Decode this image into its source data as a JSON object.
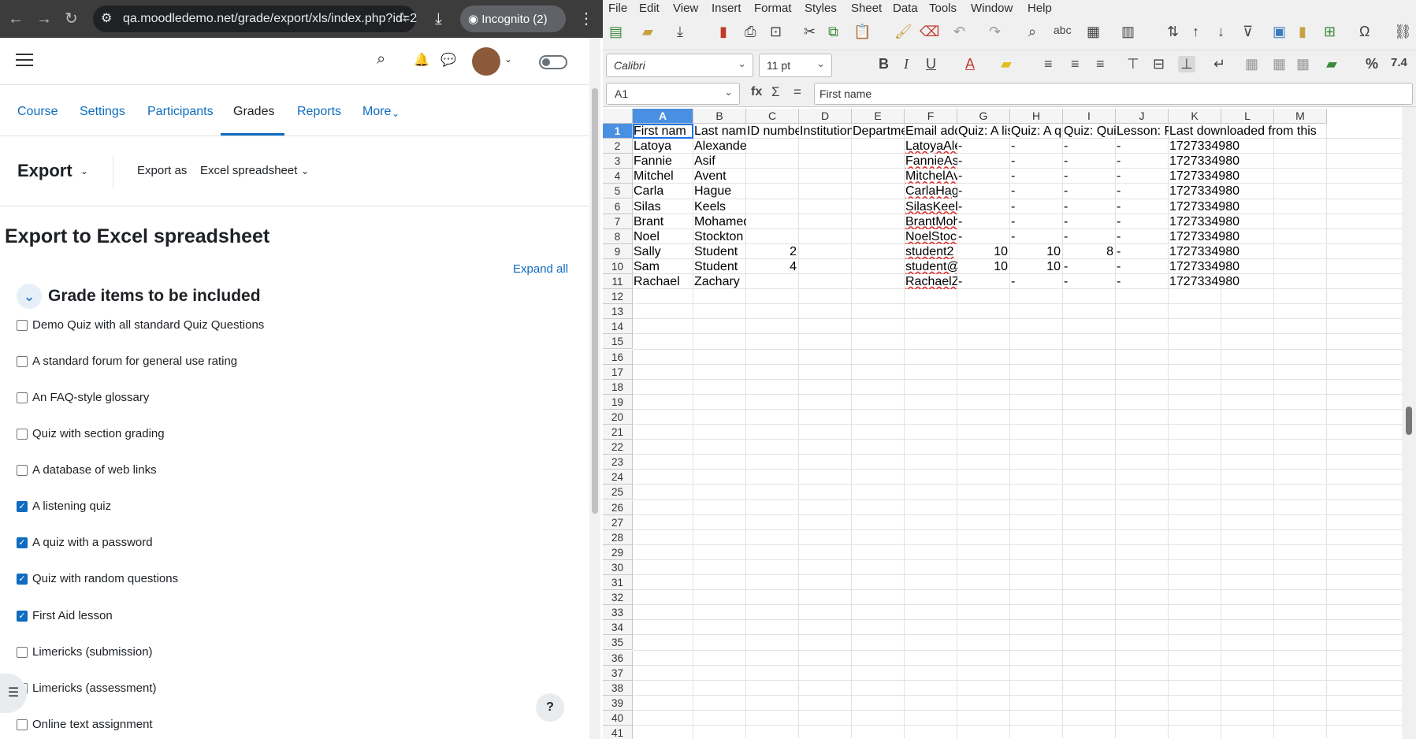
{
  "browser": {
    "url": "qa.moodledemo.net/grade/export/xls/index.php?id=2",
    "incognito_label": "Incognito (2)"
  },
  "moodle": {
    "nav_tabs": [
      "Course",
      "Settings",
      "Participants",
      "Grades",
      "Reports",
      "More"
    ],
    "active_tab": "Grades",
    "export_title": "Export",
    "export_as_label": "Export as",
    "export_format": "Excel spreadsheet",
    "page_heading": "Export to Excel spreadsheet",
    "expand_all": "Expand all",
    "section_title": "Grade items to be included",
    "grade_items": [
      {
        "label": "Demo Quiz with all standard Quiz Questions",
        "checked": false
      },
      {
        "label": "A standard forum for general use rating",
        "checked": false
      },
      {
        "label": "An FAQ-style glossary",
        "checked": false
      },
      {
        "label": "Quiz with section grading",
        "checked": false
      },
      {
        "label": "A database of web links",
        "checked": false
      },
      {
        "label": "A listening quiz",
        "checked": true
      },
      {
        "label": "A quiz with a password",
        "checked": true
      },
      {
        "label": "Quiz with random questions",
        "checked": true
      },
      {
        "label": "First Aid lesson",
        "checked": true
      },
      {
        "label": "Limericks (submission)",
        "checked": false
      },
      {
        "label": "Limericks (assessment)",
        "checked": false
      },
      {
        "label": "Online text assignment",
        "checked": false
      }
    ],
    "help_button": "?"
  },
  "calc": {
    "menus": [
      "File",
      "Edit",
      "View",
      "Insert",
      "Format",
      "Styles",
      "Sheet",
      "Data",
      "Tools",
      "Window",
      "Help"
    ],
    "font_name": "Calibri",
    "font_size": "11 pt",
    "name_box": "A1",
    "formula_value": "First name",
    "columns": [
      "A",
      "B",
      "C",
      "D",
      "E",
      "F",
      "G",
      "H",
      "I",
      "J",
      "K",
      "L",
      "M"
    ],
    "header_row": [
      "First nam",
      "Last nam",
      "ID numbe",
      "Institution",
      "Departme",
      "Email add",
      "Quiz: A lis",
      "Quiz: A q",
      "Quiz: Qui",
      "Lesson: F",
      "Last downloaded from this",
      "",
      ""
    ],
    "rows": [
      [
        "Latoya",
        "Alexander",
        "",
        "",
        "",
        "LatoyaAle",
        "-",
        "-",
        "-",
        "-",
        "1727334980"
      ],
      [
        "Fannie",
        "Asif",
        "",
        "",
        "",
        "FannieAs",
        "-",
        "-",
        "-",
        "-",
        "1727334980"
      ],
      [
        "Mitchel",
        "Avent",
        "",
        "",
        "",
        "MitchelAv",
        "-",
        "-",
        "-",
        "-",
        "1727334980"
      ],
      [
        "Carla",
        "Hague",
        "",
        "",
        "",
        "CarlaHag",
        "-",
        "-",
        "-",
        "-",
        "1727334980"
      ],
      [
        "Silas",
        "Keels",
        "",
        "",
        "",
        "SilasKeels",
        "-",
        "-",
        "-",
        "-",
        "1727334980"
      ],
      [
        "Brant",
        "Mohamed",
        "",
        "",
        "",
        "BrantMoh",
        "-",
        "-",
        "-",
        "-",
        "1727334980"
      ],
      [
        "Noel",
        "Stockton",
        "",
        "",
        "",
        "NoelStock",
        "-",
        "-",
        "-",
        "-",
        "1727334980"
      ],
      [
        "Sally",
        "Student",
        "2",
        "",
        "",
        "student2",
        "10",
        "10",
        "8",
        "-",
        "1727334980"
      ],
      [
        "Sam",
        "Student",
        "4",
        "",
        "",
        "student@",
        "10",
        "10",
        "-",
        "-",
        "1727334980"
      ],
      [
        "Rachael",
        "Zachary",
        "",
        "",
        "",
        "RachaelZ",
        "-",
        "-",
        "-",
        "-",
        "1727334980"
      ]
    ],
    "row_count": 41
  }
}
